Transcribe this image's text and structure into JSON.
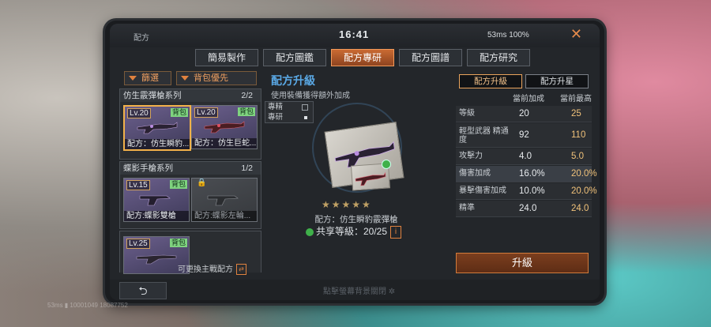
{
  "topbar": {
    "title": "配方",
    "time": "16:41",
    "status": "53ms 100%",
    "close": "✕"
  },
  "tabs": [
    {
      "label": "簡易製作"
    },
    {
      "label": "配方圖鑑"
    },
    {
      "label": "配方專研"
    },
    {
      "label": "配方圖譜"
    },
    {
      "label": "配方研究"
    }
  ],
  "filters": {
    "filter_label": "篩選",
    "bag_label": "背包優先"
  },
  "groups": [
    {
      "title": "仿生霰彈槍系列",
      "count": "2/2",
      "cards": [
        {
          "lv": "Lv.20",
          "bag": "背包",
          "name": "配方：仿生瞬豹..."
        },
        {
          "lv": "Lv.20",
          "bag": "背包",
          "name": "配方：仿生巨蛇..."
        }
      ]
    },
    {
      "title": "蝶影手槍系列",
      "count": "1/2",
      "cards": [
        {
          "lv": "Lv.15",
          "bag": "背包",
          "name": "配方:蝶影雙槍"
        },
        {
          "lv": "",
          "bag": "",
          "name": "配方:蝶影左輪..."
        }
      ]
    },
    {
      "title": "",
      "count": "",
      "cards": [
        {
          "lv": "Lv.25",
          "bag": "背包",
          "name": ""
        }
      ]
    }
  ],
  "swap_text": "可更換主戰配方",
  "middle": {
    "title": "配方升級",
    "subtitle": "使用裝備獲得額外加成",
    "legend": [
      "專精",
      "專研"
    ],
    "item_name": "配方：仿生瞬豹霰彈槍",
    "share_level": "共享等級：20/25",
    "info": "i"
  },
  "right": {
    "tabs": [
      "配方升級",
      "配方升星"
    ],
    "col_cur": "當前加成",
    "col_max": "當前最高",
    "rows": [
      {
        "label": "等級",
        "cur": "20",
        "max": "25"
      },
      {
        "label": "輕型武器 精通度",
        "cur": "92",
        "max": "110"
      },
      {
        "label": "攻擊力",
        "cur": "4.0",
        "max": "5.0"
      },
      {
        "label": "傷害加成",
        "cur": "16.0%",
        "max": "20.0%"
      },
      {
        "label": "暴擊傷害加成",
        "cur": "10.0%",
        "max": "20.0%"
      },
      {
        "label": "精準",
        "cur": "24.0",
        "max": "24.0"
      }
    ],
    "upgrade": "升級"
  },
  "bottom": {
    "hint": "點擊螢幕背景關閉 ✲"
  },
  "overlay": {
    "corner": "53ms ▮ 10001049 18087752"
  }
}
